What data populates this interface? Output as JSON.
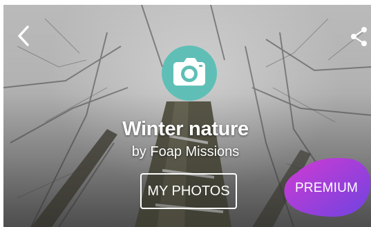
{
  "mission": {
    "title": "Winter nature",
    "subtitle": "by Foap Missions",
    "my_photos_label": "MY PHOTOS",
    "premium_label": "PREMIUM"
  },
  "icons": {
    "back": "chevron-left-icon",
    "share": "share-icon",
    "camera": "camera-icon"
  },
  "colors": {
    "camera_badge": "#5fbfb6",
    "premium_start": "#d13bd3",
    "premium_end": "#6f43e0"
  }
}
